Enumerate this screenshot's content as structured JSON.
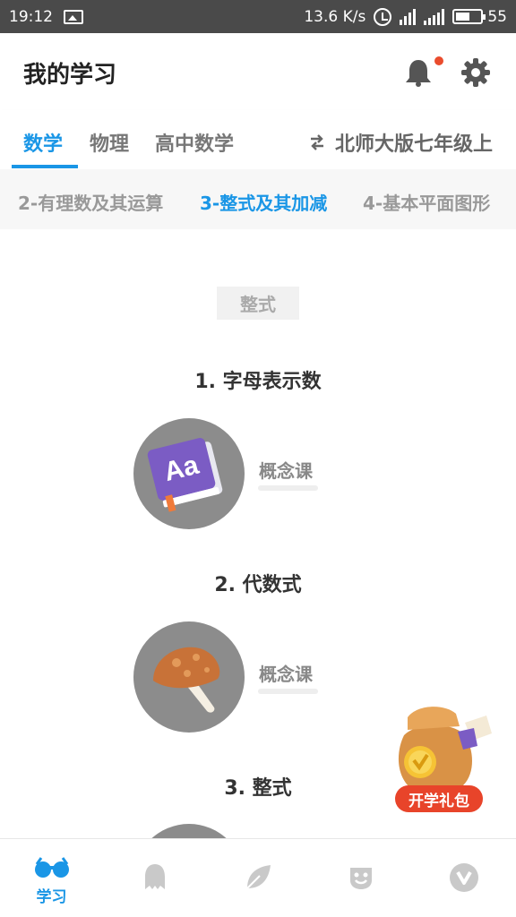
{
  "status_bar": {
    "time": "19:12",
    "net_speed": "13.6 K/s",
    "battery": "55",
    "icons": [
      "gallery-icon",
      "alarm-icon",
      "4g-signal-icon",
      "signal-icon",
      "battery-icon"
    ]
  },
  "header": {
    "title": "我的学习",
    "icons": [
      "bell-icon",
      "gear-icon"
    ],
    "notification_dot_color": "#ea4c2d"
  },
  "subject_tabs": {
    "tabs": [
      {
        "label": "数学",
        "active": true
      },
      {
        "label": "物理",
        "active": false
      },
      {
        "label": "高中数学",
        "active": false
      }
    ],
    "version_label": "北师大版七年级上",
    "version_icon": "swap-icon"
  },
  "chapters": [
    {
      "label": "2-有理数及其运算",
      "active": false
    },
    {
      "label": "3-整式及其加减",
      "active": true
    },
    {
      "label": "4-基本平面图形",
      "active": false
    }
  ],
  "section": {
    "tag": "整式",
    "lessons": [
      {
        "title": "1. 字母表示数",
        "type": "概念课",
        "icon": "book-icon"
      },
      {
        "title": "2. 代数式",
        "type": "概念课",
        "icon": "mushroom-icon"
      },
      {
        "title": "3. 整式",
        "type": "",
        "icon": ""
      }
    ]
  },
  "gift": {
    "label": "开学礼包",
    "icon": "gift-bag-icon"
  },
  "bottom_nav": [
    {
      "label": "学习",
      "icon": "glasses-icon",
      "active": true
    },
    {
      "label": "",
      "icon": "ghost-icon",
      "active": false
    },
    {
      "label": "",
      "icon": "leaf-icon",
      "active": false
    },
    {
      "label": "",
      "icon": "smile-icon",
      "active": false
    },
    {
      "label": "",
      "icon": "v-icon",
      "active": false
    }
  ],
  "colors": {
    "accent": "#1a96e6",
    "gift": "#e8442a",
    "circle": "#8c8c8c"
  }
}
